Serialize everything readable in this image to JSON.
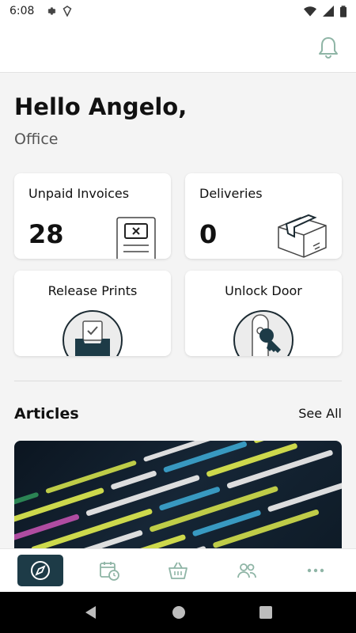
{
  "status_bar": {
    "time": "6:08"
  },
  "header": {},
  "greeting": {
    "title": "Hello Angelo,",
    "location": "Office"
  },
  "stats": [
    {
      "label": "Unpaid Invoices",
      "value": "28",
      "icon": "invoice-icon"
    },
    {
      "label": "Deliveries",
      "value": "0",
      "icon": "package-icon"
    }
  ],
  "actions": [
    {
      "label": "Release Prints",
      "icon": "print-tray-icon"
    },
    {
      "label": "Unlock Door",
      "icon": "key-icon"
    }
  ],
  "articles": {
    "title": "Articles",
    "see_all": "See All"
  },
  "bottom_nav": [
    "compass-icon",
    "calendar-clock-icon",
    "basket-icon",
    "people-icon",
    "more-icon"
  ],
  "colors": {
    "accent": "#1d3b47",
    "nav_icon": "#8fb5a6",
    "background": "#f4f4f4"
  }
}
